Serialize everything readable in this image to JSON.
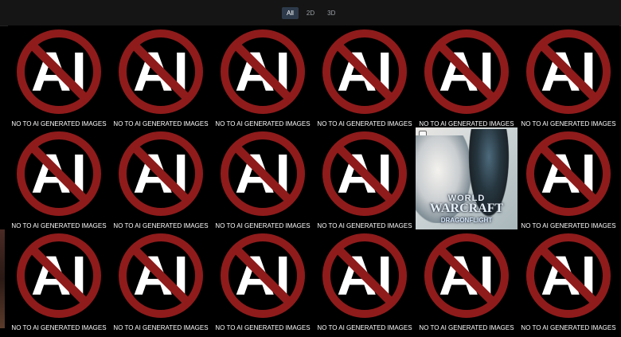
{
  "tabs": [
    {
      "label": "All",
      "active": true
    },
    {
      "label": "2D",
      "active": false
    },
    {
      "label": "3D",
      "active": false
    }
  ],
  "grid": {
    "caption": "NO TO AI GENERATED IMAGES",
    "special_title": {
      "world": "WORLD",
      "warcraft": "WARCRAFT",
      "dragonflight": "DRAGONFLIGHT"
    }
  }
}
